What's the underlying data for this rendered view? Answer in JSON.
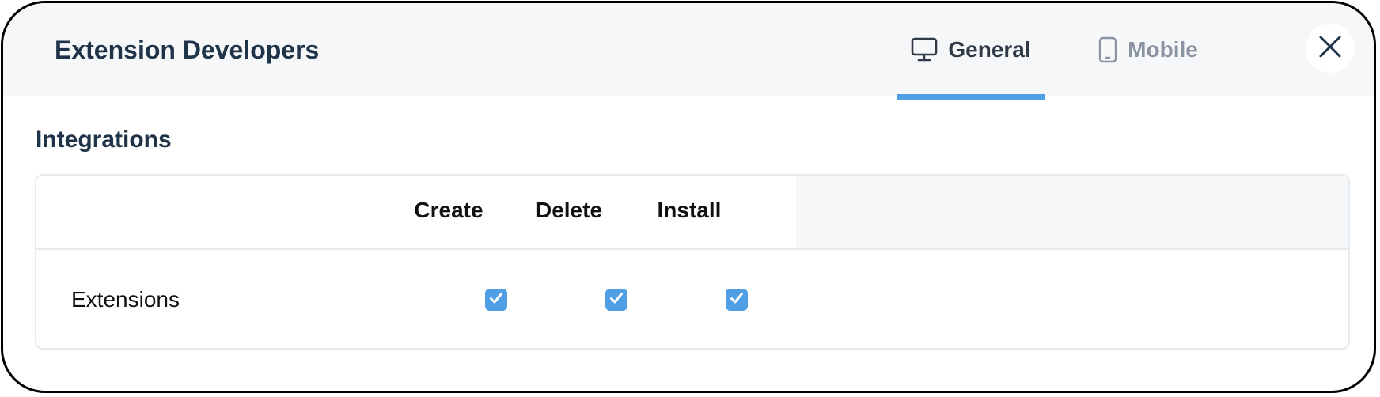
{
  "dialog": {
    "title": "Extension Developers",
    "close_icon": "close-icon"
  },
  "tabs": [
    {
      "label": "General",
      "icon": "monitor-icon",
      "active": true
    },
    {
      "label": "Mobile",
      "icon": "mobile-phone-icon",
      "active": false
    }
  ],
  "section": {
    "title": "Integrations"
  },
  "permissions_table": {
    "columns": [
      "Create",
      "Delete",
      "Install"
    ],
    "rows": [
      {
        "label": "Extensions",
        "create": true,
        "delete": true,
        "install": true
      }
    ]
  },
  "colors": {
    "accent": "#509ee3",
    "title_text": "#1f3349",
    "header_bg": "#f5f7f9",
    "inactive_tab": "#8a94a3"
  }
}
